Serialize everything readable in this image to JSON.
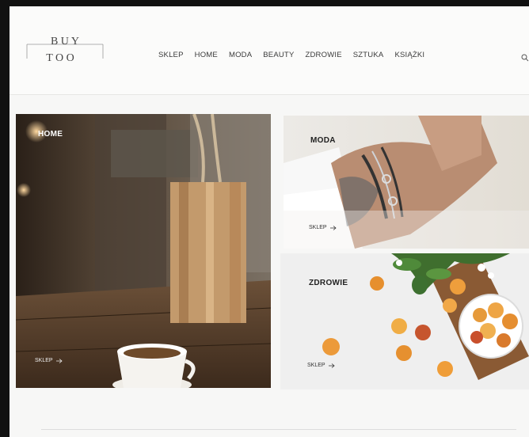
{
  "logo": {
    "line1": "B U Y",
    "line2": "T O O"
  },
  "nav": {
    "items": [
      "SKLEP",
      "HOME",
      "MODA",
      "BEAUTY",
      "ZDROWIE",
      "SZTUKA",
      "KSIĄŻKI"
    ]
  },
  "tiles": {
    "home": {
      "title": "HOME",
      "link": "SKLEP"
    },
    "moda": {
      "title": "MODA",
      "link": "SKLEP"
    },
    "zdrowie": {
      "title": "ZDROWIE",
      "link": "SKLEP"
    }
  },
  "icons": {
    "search": "search-icon",
    "arrow": "arrow-right-icon"
  }
}
